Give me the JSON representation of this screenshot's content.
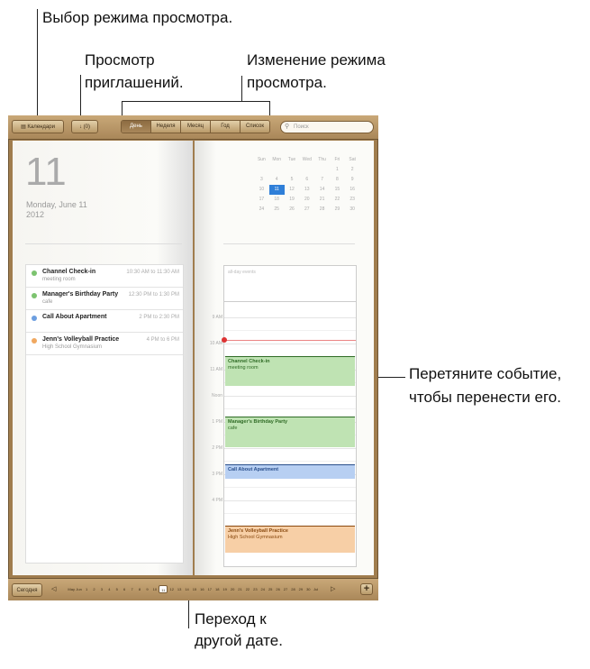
{
  "callouts": {
    "view_mode": "Выбор режима просмотра.",
    "invitations_l1": "Просмотр",
    "invitations_l2": "приглашений.",
    "change_view_l1": "Изменение режима",
    "change_view_l2": "просмотра.",
    "drag_l1": "Перетяните событие,",
    "drag_l2": "чтобы перенести его.",
    "goto_l1": "Переход к",
    "goto_l2": "другой дате."
  },
  "toolbar": {
    "calendars_label": "Календари",
    "invitations_label": "↓ (0)",
    "view_tabs": [
      "День",
      "Неделя",
      "Месяц",
      "Год",
      "Список"
    ],
    "active_tab": "День",
    "search_placeholder": "Поиск"
  },
  "day": {
    "number": "11",
    "date_line": "Monday, June 11",
    "year": "2012"
  },
  "events": [
    {
      "title": "Channel Check-in",
      "location": "meeting room",
      "time": "10:30 AM to 11:30 AM",
      "color": "#7cc36f"
    },
    {
      "title": "Manager's Birthday Party",
      "location": "cafe",
      "time": "12:30 PM to 1:30 PM",
      "color": "#7cc36f"
    },
    {
      "title": "Call About Apartment",
      "location": "",
      "time": "2 PM to 2:30 PM",
      "color": "#6c9ee0"
    },
    {
      "title": "Jenn's Volleyball Practice",
      "location": "High School Gymnasium",
      "time": "4 PM to 6 PM",
      "color": "#f0a860"
    }
  ],
  "mini_calendar": {
    "weekdays": [
      "Sun",
      "Mon",
      "Tue",
      "Wed",
      "Thu",
      "Fri",
      "Sat"
    ],
    "weeks": [
      [
        "",
        "",
        "",
        "",
        "",
        "1",
        "2"
      ],
      [
        "3",
        "4",
        "5",
        "6",
        "7",
        "8",
        "9"
      ],
      [
        "10",
        "11",
        "12",
        "13",
        "14",
        "15",
        "16"
      ],
      [
        "17",
        "18",
        "19",
        "20",
        "21",
        "22",
        "23"
      ],
      [
        "24",
        "25",
        "26",
        "27",
        "28",
        "29",
        "30"
      ]
    ],
    "selected": "11"
  },
  "day_view": {
    "all_day_label": "all-day events",
    "hours": [
      "9 AM",
      "10 AM",
      "11 AM",
      "Noon",
      "1 PM",
      "2 PM",
      "3 PM",
      "4 PM"
    ],
    "events": [
      {
        "title": "Channel Check-in",
        "location": "meeting room",
        "bg": "#bfe3b3",
        "fg": "#2f6b25"
      },
      {
        "title": "Manager's Birthday Party",
        "location": "cafe",
        "bg": "#bfe3b3",
        "fg": "#2f6b25"
      },
      {
        "title": "Call About Apartment",
        "location": "",
        "bg": "#b7cff2",
        "fg": "#2a4f8c"
      },
      {
        "title": "Jenn's Volleyball Practice",
        "location": "High School Gymnasium",
        "bg": "#f7cfa6",
        "fg": "#8a4a10"
      }
    ]
  },
  "bottombar": {
    "today_label": "Сегодня",
    "months_before": "May",
    "month_current": "Jun",
    "days": [
      "1",
      "2",
      "3",
      "4",
      "5",
      "6",
      "7",
      "8",
      "9",
      "10",
      "11",
      "12",
      "13",
      "14",
      "15",
      "16",
      "17",
      "18",
      "19",
      "20",
      "21",
      "22",
      "23",
      "24",
      "25",
      "26",
      "27",
      "28",
      "29",
      "30"
    ],
    "current_day": "11",
    "month_after": "Jul",
    "add_label": "+"
  }
}
